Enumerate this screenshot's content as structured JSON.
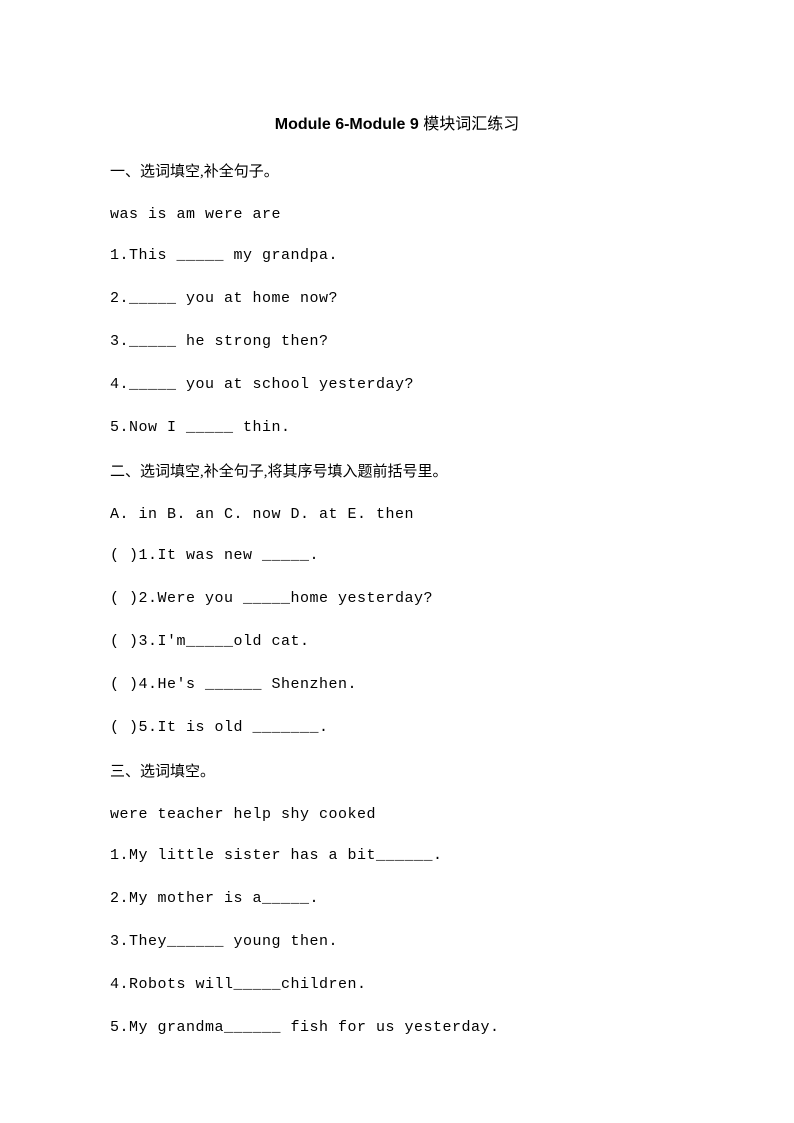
{
  "title_en": "Module 6-Module 9 ",
  "title_cn": "模块词汇练习",
  "section1": {
    "heading": "一、选词填空,补全句子。",
    "wordbank": "was  is   am   were   are",
    "items": [
      "1.This _____ my grandpa.",
      "2._____ you at home now?",
      "3._____ he strong then?",
      "4._____  you at school yesterday?",
      "5.Now I _____ thin."
    ]
  },
  "section2": {
    "heading": "二、选词填空,补全句子,将其序号填入题前括号里。",
    "wordbank": "A. in B. an C. now  D. at E. then",
    "items": [
      "( )1.It was new _____.",
      "( )2.Were you _____home yesterday?",
      "( )3.I'm_____old cat.",
      "( )4.He's ______ Shenzhen.",
      "( )5.It is old _______."
    ]
  },
  "section3": {
    "heading": "三、选词填空。",
    "wordbank": "were   teacher    help     shy     cooked",
    "items": [
      "1.My little sister has a bit______.",
      "2.My mother is a_____.",
      "3.They______ young then.",
      "4.Robots will_____children.",
      "5.My grandma______ fish for us yesterday."
    ]
  }
}
